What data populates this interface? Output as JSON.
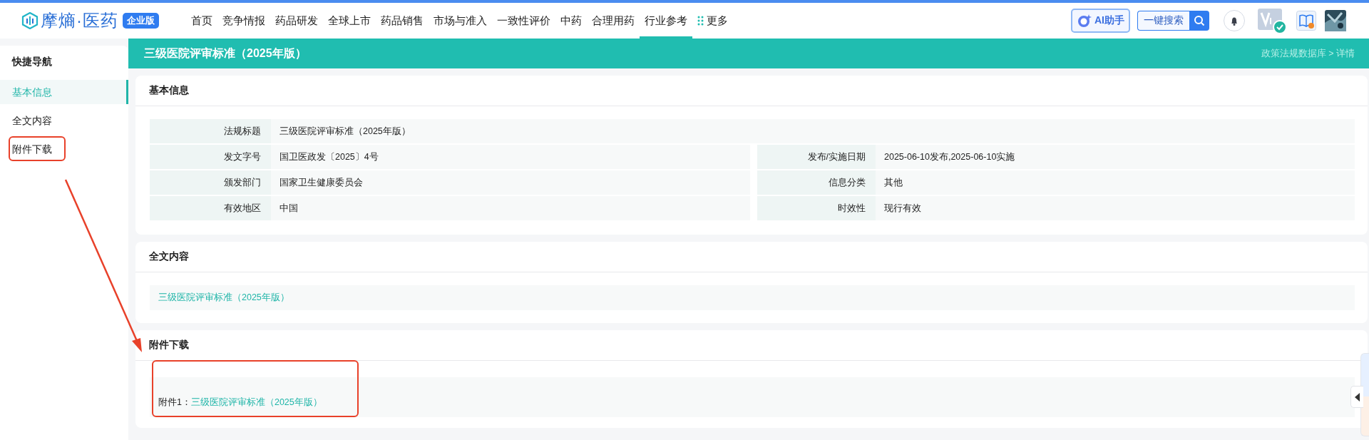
{
  "header": {
    "logo": {
      "name": "摩熵·医药",
      "badge": "企业版"
    },
    "nav": [
      {
        "label": "首页",
        "selected": false,
        "kind": "link"
      },
      {
        "label": "竞争情报",
        "selected": false,
        "kind": "link"
      },
      {
        "label": "药品研发",
        "selected": false,
        "kind": "link"
      },
      {
        "label": "全球上市",
        "selected": false,
        "kind": "link"
      },
      {
        "label": "药品销售",
        "selected": false,
        "kind": "link"
      },
      {
        "label": "市场与准入",
        "selected": false,
        "kind": "link"
      },
      {
        "label": "一致性评价",
        "selected": false,
        "kind": "link"
      },
      {
        "label": "中药",
        "selected": false,
        "kind": "link"
      },
      {
        "label": "合理用药",
        "selected": false,
        "kind": "link"
      },
      {
        "label": "行业参考",
        "selected": true,
        "kind": "link"
      },
      {
        "label": "更多",
        "selected": false,
        "kind": "more"
      }
    ],
    "ai_button": "AI助手",
    "search_button": "一键搜索"
  },
  "page_title": "三级医院评审标准（2025年版）",
  "breadcrumb": "政策法规数据库 > 详情",
  "sidebar": {
    "title": "快捷导航",
    "items": [
      {
        "label": "基本信息",
        "selected": true,
        "highlighted": false
      },
      {
        "label": "全文内容",
        "selected": false,
        "highlighted": false
      },
      {
        "label": "附件下载",
        "selected": false,
        "highlighted": true
      }
    ]
  },
  "basic_info": {
    "title": "基本信息",
    "rows": [
      [
        {
          "label": "法规标题",
          "value": "三级医院评审标准（2025年版）"
        }
      ],
      [
        {
          "label": "发文字号",
          "value": "国卫医政发〔2025〕4号"
        },
        {
          "label": "发布/实施日期",
          "value": "2025-06-10发布,2025-06-10实施"
        }
      ],
      [
        {
          "label": "颁发部门",
          "value": "国家卫生健康委员会"
        },
        {
          "label": "信息分类",
          "value": "其他"
        }
      ],
      [
        {
          "label": "有效地区",
          "value": "中国"
        },
        {
          "label": "时效性",
          "value": "现行有效"
        }
      ]
    ]
  },
  "full_text": {
    "title": "全文内容",
    "link": "三级医院评审标准（2025年版）"
  },
  "attachments": {
    "title": "附件下载",
    "highlighted": true,
    "items": [
      {
        "prefix": "附件1：",
        "link": "三级医院评审标准（2025年版）"
      }
    ]
  },
  "annotations": [
    {
      "kind": "arrow"
    }
  ]
}
